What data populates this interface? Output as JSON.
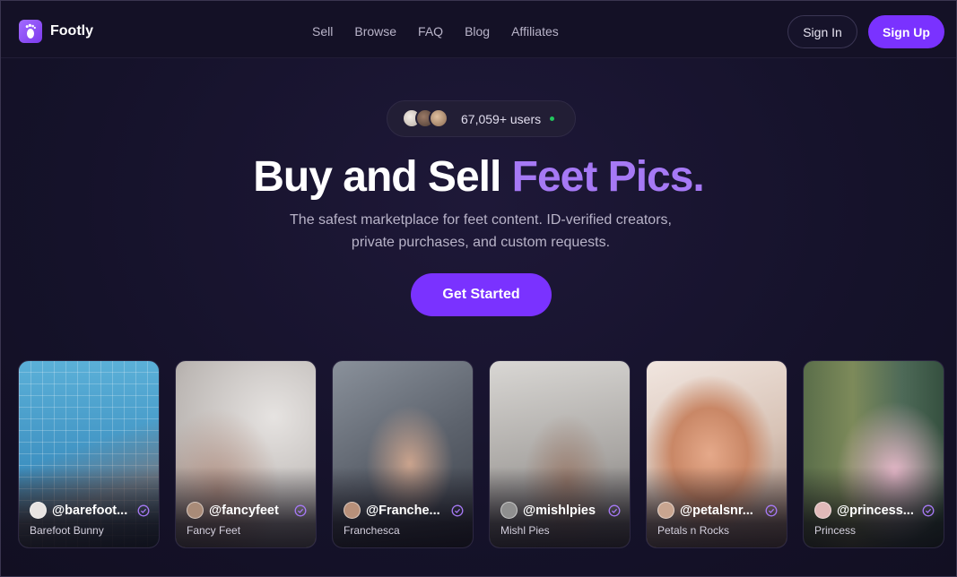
{
  "brand": {
    "name": "Footly"
  },
  "nav": {
    "links": [
      "Sell",
      "Browse",
      "FAQ",
      "Blog",
      "Affiliates"
    ],
    "sign_in": "Sign In",
    "sign_up": "Sign Up"
  },
  "hero": {
    "users": "67,059+ users",
    "title_main": "Buy and Sell ",
    "title_accent": "Feet Pics.",
    "subtitle_line1": "The safest marketplace for feet content. ID-verified creators,",
    "subtitle_line2": "private purchases, and custom requests.",
    "cta": "Get Started"
  },
  "creators": [
    {
      "handle": "@barefoot...",
      "name": "Barefoot Bunny"
    },
    {
      "handle": "@fancyfeet",
      "name": "Fancy Feet"
    },
    {
      "handle": "@Franche...",
      "name": "Franchesca"
    },
    {
      "handle": "@mishlpies",
      "name": "Mishl Pies"
    },
    {
      "handle": "@petalsnr...",
      "name": "Petals n Rocks"
    },
    {
      "handle": "@princess...",
      "name": "Princess"
    }
  ],
  "colors": {
    "accent": "#7a32ff",
    "accent_text": "#a679f5",
    "background": "#15122a",
    "verified": "#a679f5"
  },
  "icons": {
    "logo": "footprint-icon",
    "verified": "verified-check-icon",
    "online": "online-dot"
  }
}
